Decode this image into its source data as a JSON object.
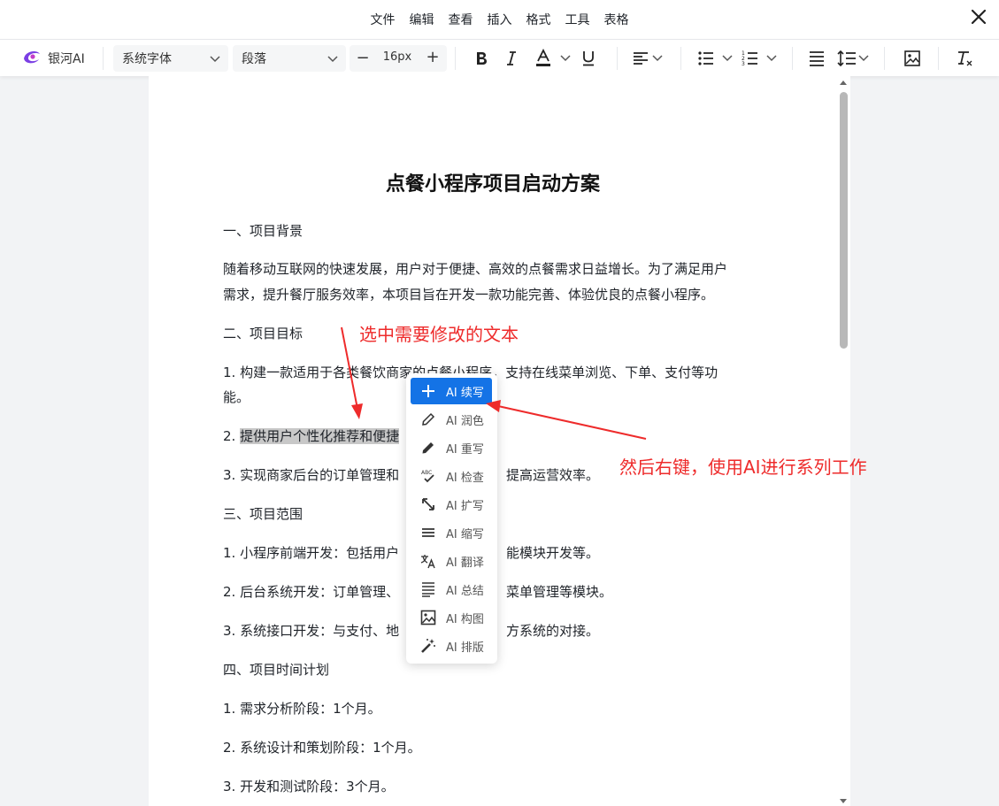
{
  "menubar": {
    "items": [
      "文件",
      "编辑",
      "查看",
      "插入",
      "格式",
      "工具",
      "表格"
    ]
  },
  "toolbar": {
    "brand": "银河AI",
    "font_family": "系统字体",
    "block_format": "段落",
    "font_size": "16px",
    "size_minus": "−",
    "size_plus": "+"
  },
  "document": {
    "title": "点餐小程序项目启动方案",
    "paragraphs": [
      "一、项目背景",
      "随着移动互联网的快速发展，用户对于便捷、高效的点餐需求日益增长。为了满足用户",
      "需求，提升餐厅服务效率，本项目旨在开发一款功能完善、体验优良的点餐小程序。",
      "二、项目目标",
      "1. 构建一款适用于各类餐饮商家的点餐小程序，支持在线菜单浏览、下单、支付等功",
      "能。",
      "2. ",
      "提供用户个性化推荐和便捷",
      "3. 实现商家后台的订单管理和",
      "提高运营效率。",
      "三、项目范围",
      "1. 小程序前端开发：包括用户",
      "能模块开发等。",
      "2. 后台系统开发：订单管理、",
      "菜单管理等模块。",
      "3. 系统接口开发：与支付、地",
      "方系统的对接。",
      "四、项目时间计划",
      "1. 需求分析阶段：1个月。",
      "2. 系统设计和策划阶段：1个月。",
      "3. 开发和测试阶段：3个月。"
    ]
  },
  "context_menu": {
    "items": [
      {
        "label": "AI 续写",
        "icon": "plus-icon"
      },
      {
        "label": "AI 润色",
        "icon": "pencil-outline-icon"
      },
      {
        "label": "AI 重写",
        "icon": "pencil-icon"
      },
      {
        "label": "AI 检查",
        "icon": "spellcheck-icon"
      },
      {
        "label": "AI 扩写",
        "icon": "expand-icon"
      },
      {
        "label": "AI 缩写",
        "icon": "lines-icon"
      },
      {
        "label": "AI 翻译",
        "icon": "translate-icon"
      },
      {
        "label": "AI 总结",
        "icon": "summary-icon"
      },
      {
        "label": "AI 构图",
        "icon": "image-icon"
      },
      {
        "label": "AI 排版",
        "icon": "magic-wand-icon"
      }
    ],
    "active_index": 0
  },
  "annotations": {
    "select_hint": "选中需要修改的文本",
    "right_click_hint": "然后右键，使用AI进行系列工作"
  },
  "colors": {
    "accent": "#1473e6",
    "annotation": "#ee2b2b",
    "brand_purple": "#7b3fe4"
  }
}
